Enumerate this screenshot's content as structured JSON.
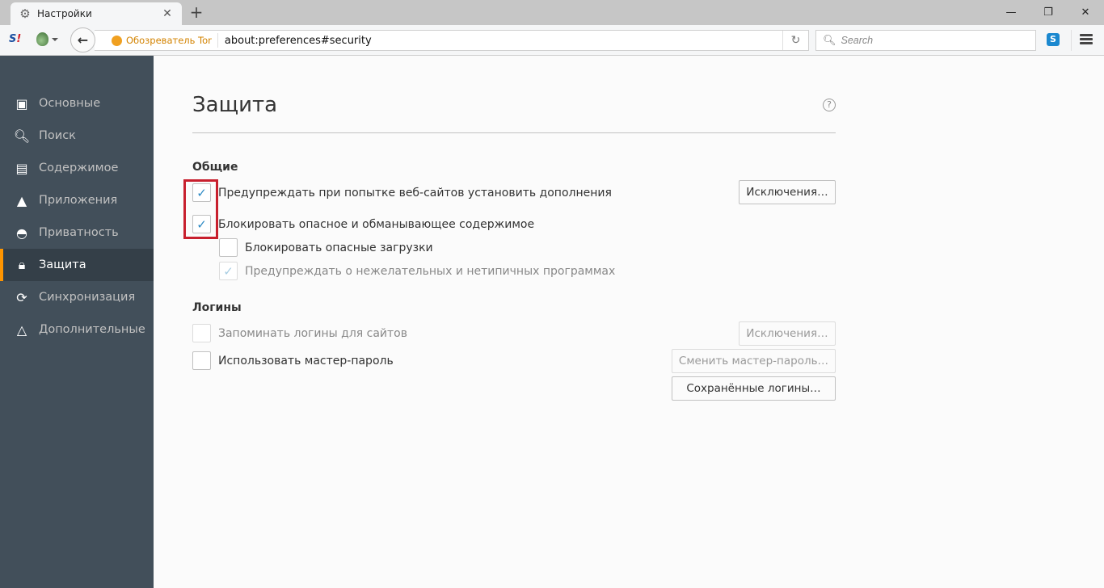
{
  "tabstrip": {
    "tab_title": "Настройки",
    "tab_icon": "gear-icon",
    "new_tab_label": "+",
    "window_controls": {
      "minimize": "—",
      "restore": "❐",
      "close": "✕"
    }
  },
  "navbar": {
    "identity_label": "Обозреватель Tor",
    "url": "about:preferences#security",
    "search_placeholder": "Search"
  },
  "sidebar": {
    "items": [
      {
        "label": "Основные",
        "icon": "general-icon",
        "selected": false
      },
      {
        "label": "Поиск",
        "icon": "search-icon",
        "selected": false
      },
      {
        "label": "Содержимое",
        "icon": "document-icon",
        "selected": false
      },
      {
        "label": "Приложения",
        "icon": "rocket-icon",
        "selected": false
      },
      {
        "label": "Приватность",
        "icon": "mask-icon",
        "selected": false
      },
      {
        "label": "Защита",
        "icon": "lock-icon",
        "selected": true
      },
      {
        "label": "Синхронизация",
        "icon": "sync-icon",
        "selected": false
      },
      {
        "label": "Дополнительные",
        "icon": "wizard-hat-icon",
        "selected": false
      }
    ]
  },
  "main": {
    "title": "Защита",
    "help_label": "?",
    "general": {
      "title": "Общие",
      "warn_addons": {
        "label": "Предупреждать при попытке веб-сайтов установить дополнения",
        "checked": true
      },
      "exceptions_button": "Исключения…",
      "block_deceptive": {
        "label": "Блокировать опасное и обманывающее содержимое",
        "checked": true
      },
      "block_downloads": {
        "label": "Блокировать опасные загрузки",
        "checked": false
      },
      "warn_unwanted": {
        "label": "Предупреждать о нежелательных и нетипичных программах",
        "checked": true,
        "disabled": true
      }
    },
    "logins": {
      "title": "Логины",
      "remember": {
        "label": "Запоминать логины для сайтов",
        "checked": false,
        "disabled": true
      },
      "exceptions_button": "Исключения…",
      "master_password": {
        "label": "Использовать мастер-пароль",
        "checked": false
      },
      "change_master_button": "Сменить мастер-пароль…",
      "saved_logins_button": "Сохранённые логины…"
    },
    "check_glyph": "✓"
  }
}
